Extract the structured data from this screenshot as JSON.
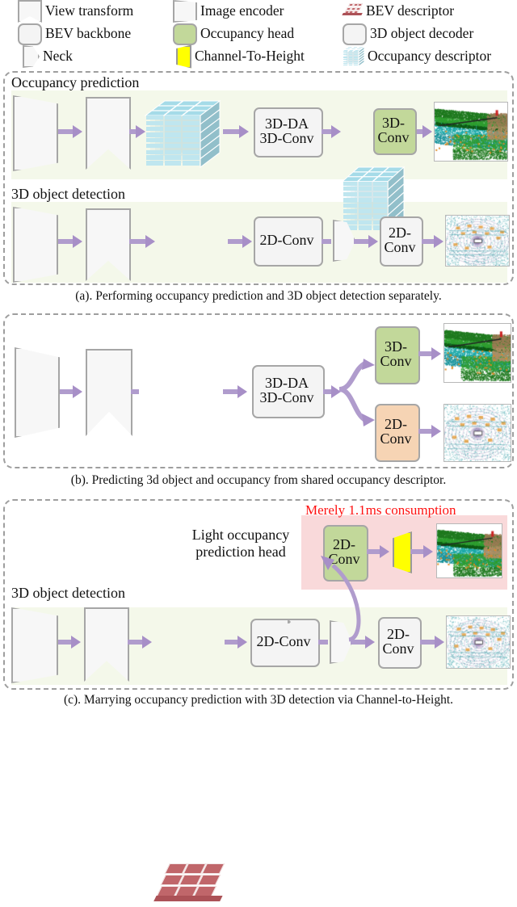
{
  "legend": {
    "items": [
      {
        "id": "view-transform",
        "label": "View transform",
        "icon": "bowtie-shape-icon",
        "color": "#f7f7f7"
      },
      {
        "id": "image-encoder",
        "label": "Image encoder",
        "icon": "trapezoid-shape-icon",
        "color": "#f7f7f7"
      },
      {
        "id": "bev-descriptor",
        "label": "BEV descriptor",
        "icon": "red-grid-icon",
        "color": "#c0666a"
      },
      {
        "id": "bev-backbone",
        "label": "BEV backbone",
        "icon": "rounded-rect-icon",
        "color": "#f4f4f4"
      },
      {
        "id": "occupancy-head",
        "label": "Occupancy head",
        "icon": "green-rounded-rect-icon",
        "color": "#c2d89a"
      },
      {
        "id": "object-decoder",
        "label": "3D object decoder",
        "icon": "rounded-rect-icon",
        "color": "#f4f4f4"
      },
      {
        "id": "neck",
        "label": "Neck",
        "icon": "neck-shape-icon",
        "color": "#f7f7f7"
      },
      {
        "id": "channel-to-height",
        "label": "Channel-To-Height",
        "icon": "yellow-trapezoid-icon",
        "color": "#ffff00"
      },
      {
        "id": "occupancy-descriptor",
        "label": "Occupancy descriptor",
        "icon": "blue-voxel-cube-icon",
        "color": "#a5dbe8"
      }
    ]
  },
  "panel_a": {
    "row1_label": "Occupancy prediction",
    "row2_label": "3D object detection",
    "block_3dda_line1": "3D-DA",
    "block_3dda_line2": "3D-Conv",
    "block_3dconv_line1": "3D-",
    "block_3dconv_line2": "Conv",
    "block_2dconv_a": "2D-Conv",
    "block_2dconv_b_line1": "2D-",
    "block_2dconv_b_line2": "Conv",
    "caption": "(a). Performing occupancy prediction and 3D object detection separately."
  },
  "panel_b": {
    "block_3dda_line1": "3D-DA",
    "block_3dda_line2": "3D-Conv",
    "block_3dconv_line1": "3D-",
    "block_3dconv_line2": "Conv",
    "block_2dconv_line1": "2D-",
    "block_2dconv_line2": "Conv",
    "caption": "(b). Predicting 3d object and occupancy from shared occupancy descriptor."
  },
  "panel_c": {
    "highlight_note": "Merely 1.1ms consumption",
    "head_label_line1": "Light occupancy",
    "head_label_line2": "prediction head",
    "head_block_line1": "2D-",
    "head_block_line2": "Conv",
    "row_label": "3D object detection",
    "block_2dconv_a": "2D-Conv",
    "block_2dconv_b_line1": "2D-",
    "block_2dconv_b_line2": "Conv",
    "caption": "(c). Marrying occupancy prediction with 3D detection via Channel-to-Height."
  },
  "colors": {
    "occupancy_head": "#c2d89a",
    "object_decoder_b": "#f6d4b4",
    "bev_descriptor": "#c0666a",
    "occupancy_descriptor": "#a5dbe8",
    "channel_to_height": "#ffff00",
    "highlight_pink": "#f9d9da",
    "band_green": "#f4f8ea",
    "arrow_purple": "#b09ccd",
    "note_red": "#ff1111",
    "outline_gray": "#a6a6a6"
  }
}
